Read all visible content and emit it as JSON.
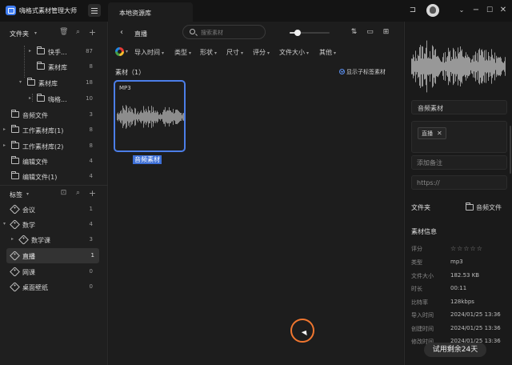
{
  "app": {
    "title": "嗨格式素材管理大师"
  },
  "tabs": [
    {
      "label": "本地资源库"
    }
  ],
  "sidebar": {
    "folders_title": "文件夹",
    "folders": [
      {
        "label": "快手...",
        "count": "87"
      },
      {
        "label": "素材库",
        "count": "8"
      },
      {
        "label": "素材库",
        "count": "18"
      },
      {
        "label": "嗨格...",
        "count": "10"
      },
      {
        "label": "音频文件",
        "count": "3"
      },
      {
        "label": "工作素材库(1)",
        "count": "8"
      },
      {
        "label": "工作素材库(2)",
        "count": "8"
      },
      {
        "label": "编辑文件",
        "count": "4"
      },
      {
        "label": "编辑文件(1)",
        "count": "4"
      }
    ],
    "tags_title": "标签",
    "tags": [
      {
        "label": "会议",
        "count": "1"
      },
      {
        "label": "数学",
        "count": "4"
      },
      {
        "label": "数学课",
        "count": "3"
      },
      {
        "label": "直播",
        "count": "1"
      },
      {
        "label": "网课",
        "count": "0"
      },
      {
        "label": "桌面壁纸",
        "count": "0"
      }
    ]
  },
  "main": {
    "title": "直播",
    "search_placeholder": "搜索素材",
    "zoom_level": 0.2,
    "filters": [
      "导入时间",
      "类型",
      "形状",
      "尺寸",
      "评分",
      "文件大小",
      "其他"
    ],
    "items_label": "素材（1）",
    "subtag_toggle": "显示子标签素材",
    "asset": {
      "badge": "MP3",
      "name": "音频素材"
    }
  },
  "right_panel": {
    "name": "音频素材",
    "tag": "直播",
    "note_placeholder": "添加备注",
    "url_placeholder": "https://",
    "folder_heading": "文件夹",
    "folder_value": "音频文件",
    "info_heading": "素材信息",
    "rating_label": "评分",
    "rating_value": 0,
    "rating_max": 5,
    "info": [
      {
        "key": "类型",
        "value": "mp3"
      },
      {
        "key": "文件大小",
        "value": "182.53 KB"
      },
      {
        "key": "时长",
        "value": "00:11"
      },
      {
        "key": "比特率",
        "value": "128kbps"
      },
      {
        "key": "导入时间",
        "value": "2024/01/25 13:36"
      },
      {
        "key": "创建时间",
        "value": "2024/01/25 13:36"
      },
      {
        "key": "修改时间",
        "value": "2024/01/25 13:36"
      }
    ]
  },
  "toast": {
    "text": "试用剩余24天"
  },
  "colors": {
    "accent": "#4c7ee8",
    "selection": "#3d6fd6",
    "cursor_ring": "#f0762f"
  }
}
